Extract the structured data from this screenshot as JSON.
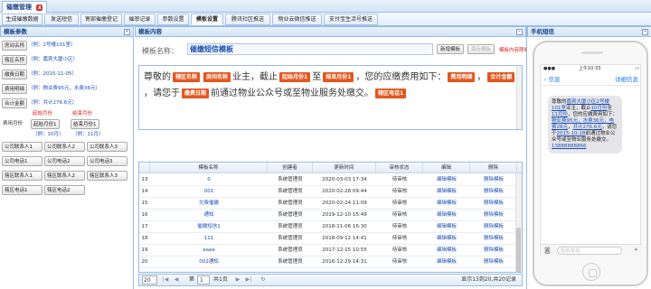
{
  "app": {
    "title": "催缴管理",
    "close": "x"
  },
  "tabs": [
    {
      "label": "生成催缴数据"
    },
    {
      "label": "发送短信"
    },
    {
      "label": "寄部催缴登记"
    },
    {
      "label": "催审记录"
    },
    {
      "label": "参数设置"
    },
    {
      "label": "模板设置",
      "active": true
    },
    {
      "label": "腾讯社区推送"
    },
    {
      "label": "物业云微信推送"
    },
    {
      "label": "支付宝生活号推送"
    }
  ],
  "left": {
    "title": "模板参数",
    "fields": [
      {
        "btn": "房间名称",
        "hint": "（例：2号楼101室）"
      },
      {
        "btn": "辖区名称",
        "hint": "（例：嘉宾大厦小区）"
      },
      {
        "btn": "缴费日期",
        "hint": "（例：2015-11-05）"
      },
      {
        "btn": "费用明细",
        "hint": "（例：物业费95元，水费36元）"
      },
      {
        "btn": "合计金额",
        "hint": "（例：共计276.6元）"
      }
    ],
    "start_label": "起始月份",
    "end_label": "结束月份",
    "fee_month": "费用月份",
    "start_btn": "起始月份1",
    "end_btn": "结束月份1",
    "start_hint": "（例：10月）",
    "end_hint": "（例：11月）",
    "contacts": [
      "公司联系人1",
      "公司联系人2",
      "公司联系人3",
      "公司电话1",
      "公司电话2",
      "公司电话3",
      "辖区联系人1",
      "辖区联系人2",
      "辖区联系人3",
      "辖区电话1",
      "辖区电话2"
    ]
  },
  "center": {
    "title": "模板内容",
    "name_label": "模板名称：",
    "name_value": "催缴短信模板",
    "btn_new": "新增模板",
    "btn_save": "保存模板",
    "note": "模板内容限制200字以内",
    "editor": {
      "t1": "尊敬的",
      "c1": "辖区名称",
      "c2": "房间名称",
      "t2": "业主，截止",
      "c3": "起始月份1",
      "t3": "至",
      "c4": "结束月份1",
      "t4": "，您的应缴费用如下：",
      "c5": "费用明细",
      "t5": "，",
      "c6": "合计金额",
      "t6": "，请您于",
      "c7": "缴费日期",
      "t7": "前通过物业公众号或至物业服务处缴交。",
      "c8": "辖区电话1"
    },
    "columns": [
      "模板名称",
      "创建者",
      "更新时间",
      "审核状态",
      "编辑",
      "删除"
    ],
    "rows": [
      {
        "no": "13",
        "name": "0",
        "creator": "系统管理员",
        "time": "2020-03-03 17:34",
        "status": "待审核",
        "edit": "编辑模板",
        "del": "删除模板"
      },
      {
        "no": "14",
        "name": "001",
        "creator": "系统管理员",
        "time": "2020-02-28 09:44",
        "status": "待审核",
        "edit": "编辑模板",
        "del": "删除模板"
      },
      {
        "no": "15",
        "name": "欠费催缴",
        "creator": "系统管理员",
        "time": "2020-02-24 11:09",
        "status": "待审核",
        "edit": "编辑模板",
        "del": "删除模板"
      },
      {
        "no": "16",
        "name": "通知",
        "creator": "系统管理员",
        "time": "2019-12-10 15:49",
        "status": "待审核",
        "edit": "编辑模板",
        "del": "删除模板"
      },
      {
        "no": "17",
        "name": "催缴短信1",
        "creator": "系统管理员",
        "time": "2018-11-06 16:30",
        "status": "待审核",
        "edit": "编辑模板",
        "del": "删除模板"
      },
      {
        "no": "18",
        "name": "111",
        "creator": "系统管理员",
        "time": "2018-09-12 14:41",
        "status": "待审核",
        "edit": "编辑模板",
        "del": "删除模板"
      },
      {
        "no": "19",
        "name": "aaaa",
        "creator": "系统管理员",
        "time": "2017-12-15 10:55",
        "status": "待审核",
        "edit": "编辑模板",
        "del": "删除模板"
      },
      {
        "no": "20",
        "name": "002通知",
        "creator": "系统管理员",
        "time": "2016-12-29 14:31",
        "status": "待审核",
        "edit": "编辑模板",
        "del": "删除模板"
      }
    ],
    "pager": {
      "page_size": "20",
      "page_label": "第",
      "page": "1",
      "total_pages": "共1页",
      "summary": "显示13到20,共20记录"
    }
  },
  "right": {
    "title": "手机短信",
    "time": "上午10:33",
    "back": "信息",
    "detail": "详细信息",
    "sms": {
      "p1": "尊敬的",
      "h1": "嘉宾大厦小区",
      "h2": "2号楼101室",
      "p2": "业主，截止",
      "h3": "10月份",
      "p3": "至",
      "h4": "11月份",
      "p4": "，您的应缴费用如下：",
      "h5": "物业费95元，水费36元，电费28元",
      "p5": "，",
      "h6": "共计276.6元",
      "p6": "，请您于",
      "h7": "2015-10-28",
      "p7": "前通过物业公众号或至物业服务处缴交。",
      "h8": "13888888866"
    },
    "composer_placeholder": "短信/彩信"
  }
}
